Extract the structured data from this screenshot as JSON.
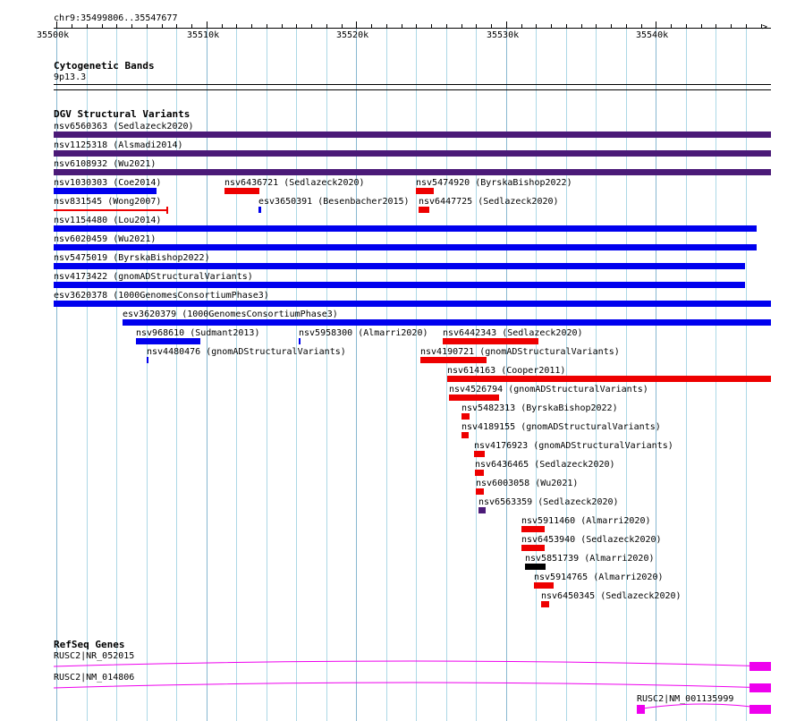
{
  "region": "chr9:35499806..35547677",
  "ruler": {
    "ticks": [
      {
        "label": "35500k",
        "pos": 35500000
      },
      {
        "label": "35510k",
        "pos": 35510000
      },
      {
        "label": "35520k",
        "pos": 35520000
      },
      {
        "label": "35530k",
        "pos": 35530000
      },
      {
        "label": "35540k",
        "pos": 35540000
      }
    ],
    "start": 35499806,
    "end": 35547677
  },
  "tracks": {
    "cytobands": {
      "title": "Cytogenetic Bands",
      "band": "9p13.3"
    },
    "dgv": {
      "title": "DGV Structural Variants",
      "colors": {
        "gain": "#0000ee",
        "loss": "#ee0000",
        "both": "#4b1a78",
        "other": "#000000"
      }
    },
    "refseq": {
      "title": "RefSeq Genes"
    }
  },
  "features": [
    {
      "label": "nsv6560363 (Sedlazeck2020)",
      "type": "both",
      "start": 35499806,
      "end": 35547677,
      "row": 0
    },
    {
      "label": "nsv1125318 (Alsmadi2014)",
      "type": "both",
      "start": 35499806,
      "end": 35547677,
      "row": 1
    },
    {
      "label": "nsv6108932 (Wu2021)",
      "type": "both",
      "start": 35499806,
      "end": 35547677,
      "row": 2
    },
    {
      "label": "nsv1030303 (Coe2014)",
      "type": "gain",
      "start": 35499806,
      "end": 35506700,
      "row": 3
    },
    {
      "label": "nsv6436721 (Sedlazeck2020)",
      "type": "loss",
      "start": 35511200,
      "end": 35513550,
      "row": 3
    },
    {
      "label": "nsv5474920 (ByrskaBishop2022)",
      "type": "loss",
      "start": 35524000,
      "end": 35525200,
      "row": 3
    },
    {
      "label": "nsv831545 (Wong2007)",
      "type": "lossline",
      "start": 35499806,
      "end": 35507400,
      "row": 4
    },
    {
      "label": "esv3650391 (Besenbacher2015)",
      "type": "gain",
      "start": 35513500,
      "end": 35513650,
      "row": 4
    },
    {
      "label": "nsv6447725 (Sedlazeck2020)",
      "type": "loss",
      "start": 35524150,
      "end": 35524900,
      "row": 4
    },
    {
      "label": "nsv1154480 (Lou2014)",
      "type": "gain",
      "start": 35499806,
      "end": 35546700,
      "row": 5
    },
    {
      "label": "nsv6020459 (Wu2021)",
      "type": "gain",
      "start": 35499806,
      "end": 35546700,
      "row": 6
    },
    {
      "label": "nsv5475019 (ByrskaBishop2022)",
      "type": "gain",
      "start": 35499806,
      "end": 35545950,
      "row": 7
    },
    {
      "label": "nsv4173422 (gnomADStructuralVariants)",
      "type": "gain",
      "start": 35499806,
      "end": 35545950,
      "row": 8
    },
    {
      "label": "esv3620378 (1000GenomesConsortiumPhase3)",
      "type": "gain",
      "start": 35499806,
      "end": 35547677,
      "row": 9
    },
    {
      "label": "esv3620379 (1000GenomesConsortiumPhase3)",
      "type": "gain",
      "start": 35504400,
      "end": 35547677,
      "row": 10
    },
    {
      "label": "nsv968610 (Sudmant2013)",
      "type": "gain",
      "start": 35505300,
      "end": 35509600,
      "row": 11
    },
    {
      "label": "nsv5958300 (Almarri2020)",
      "type": "gain",
      "start": 35516150,
      "end": 35516300,
      "row": 11
    },
    {
      "label": "nsv6442343 (Sedlazeck2020)",
      "type": "loss",
      "start": 35525800,
      "end": 35532150,
      "row": 11
    },
    {
      "label": "nsv4480476 (gnomADStructuralVariants)",
      "type": "gain",
      "start": 35506000,
      "end": 35506150,
      "row": 12
    },
    {
      "label": "nsv4190721 (gnomADStructuralVariants)",
      "type": "loss",
      "start": 35524300,
      "end": 35528700,
      "row": 12
    },
    {
      "label": "nsv614163 (Cooper2011)",
      "type": "loss",
      "start": 35526050,
      "end": 35547677,
      "row": 13
    },
    {
      "label": "nsv4526794 (gnomADStructuralVariants)",
      "type": "loss",
      "start": 35526200,
      "end": 35529550,
      "row": 14
    },
    {
      "label": "nsv5482313 (ByrskaBishop2022)",
      "type": "loss",
      "start": 35527050,
      "end": 35527550,
      "row": 15
    },
    {
      "label": "nsv4189155 (gnomADStructuralVariants)",
      "type": "loss",
      "start": 35527050,
      "end": 35527500,
      "row": 16
    },
    {
      "label": "nsv4176923 (gnomADStructuralVariants)",
      "type": "loss",
      "start": 35527850,
      "end": 35528550,
      "row": 17
    },
    {
      "label": "nsv6436465 (Sedlazeck2020)",
      "type": "loss",
      "start": 35527900,
      "end": 35528500,
      "row": 18
    },
    {
      "label": "nsv6003058 (Wu2021)",
      "type": "loss",
      "start": 35528000,
      "end": 35528500,
      "row": 19
    },
    {
      "label": "nsv6563359 (Sedlazeck2020)",
      "type": "both",
      "start": 35528150,
      "end": 35528650,
      "row": 20
    },
    {
      "label": "nsv5911460 (Almarri2020)",
      "type": "loss",
      "start": 35531050,
      "end": 35532550,
      "row": 21
    },
    {
      "label": "nsv6453940 (Sedlazeck2020)",
      "type": "loss",
      "start": 35531050,
      "end": 35532550,
      "row": 22
    },
    {
      "label": "nsv5851739 (Almarri2020)",
      "type": "other",
      "start": 35531250,
      "end": 35532650,
      "row": 23
    },
    {
      "label": "nsv5914765 (Almarri2020)",
      "type": "loss",
      "start": 35531850,
      "end": 35533150,
      "row": 24
    },
    {
      "label": "nsv6450345 (Sedlazeck2020)",
      "type": "loss",
      "start": 35532350,
      "end": 35532850,
      "row": 25
    }
  ],
  "genes": [
    {
      "label": "RUSC2|NR_052015",
      "start": 35499806,
      "end": 35547677,
      "row": 0
    },
    {
      "label": "RUSC2|NM_014806",
      "start": 35499806,
      "end": 35547677,
      "row": 1
    },
    {
      "label": "RUSC2|NM_001135999",
      "start": 35538700,
      "end": 35547677,
      "row": 2
    }
  ],
  "gene_color": "#ee00ee"
}
